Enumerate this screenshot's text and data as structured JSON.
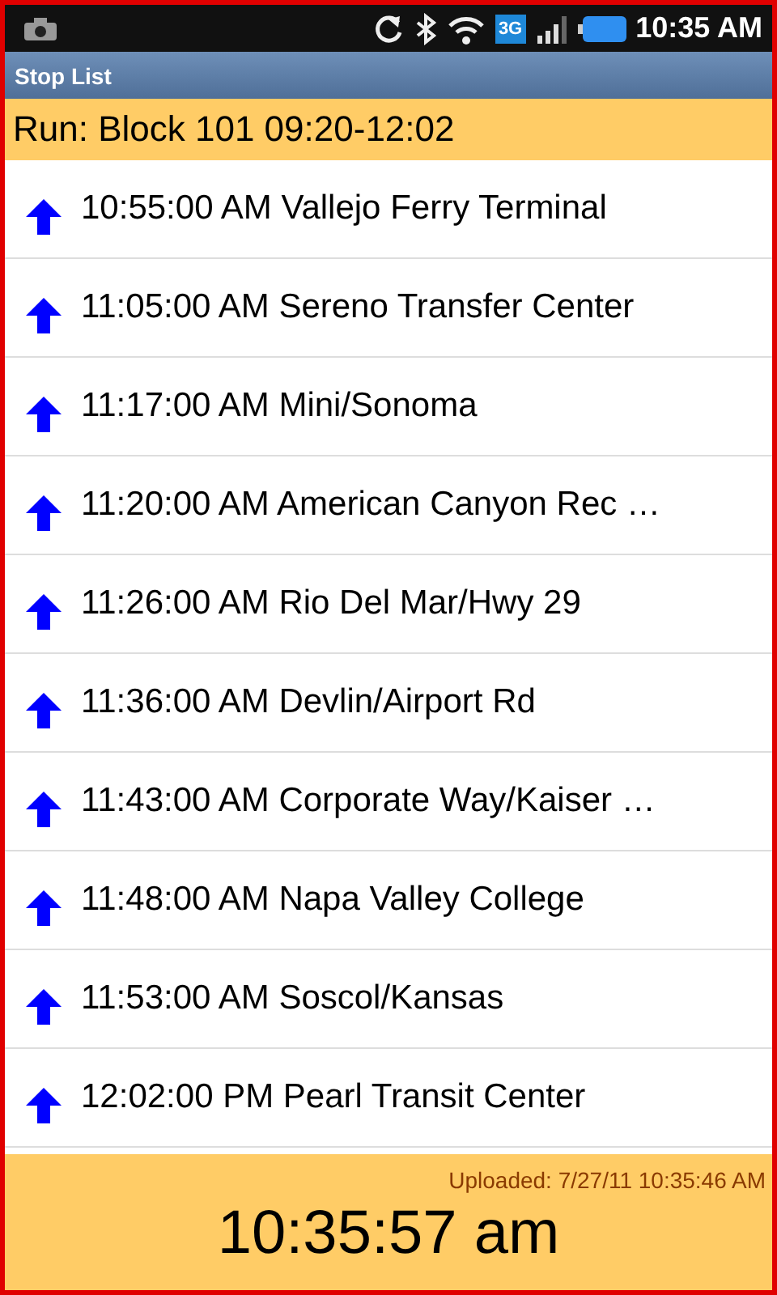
{
  "status_bar": {
    "network_badge": "3G",
    "time": "10:35 AM"
  },
  "window": {
    "title": "Stop List"
  },
  "run_header": "Run: Block 101 09:20-12:02",
  "stops": [
    {
      "kind": "up",
      "text": "10:55:00 AM Vallejo Ferry Terminal"
    },
    {
      "kind": "up",
      "text": "11:05:00 AM Sereno Transfer Center"
    },
    {
      "kind": "up",
      "text": "11:17:00 AM Mini/Sonoma"
    },
    {
      "kind": "up",
      "text": "11:20:00 AM American Canyon Rec …"
    },
    {
      "kind": "up",
      "text": "11:26:00 AM Rio Del Mar/Hwy 29"
    },
    {
      "kind": "up",
      "text": "11:36:00 AM Devlin/Airport Rd"
    },
    {
      "kind": "up",
      "text": "11:43:00 AM Corporate Way/Kaiser …"
    },
    {
      "kind": "up",
      "text": "11:48:00 AM Napa Valley College"
    },
    {
      "kind": "up",
      "text": "11:53:00 AM Soscol/Kansas"
    },
    {
      "kind": "up",
      "text": "12:02:00 PM Pearl Transit Center"
    }
  ],
  "footer": {
    "uploaded": "Uploaded: 7/27/11 10:35:46 AM",
    "clock": "10:35:57 am"
  }
}
